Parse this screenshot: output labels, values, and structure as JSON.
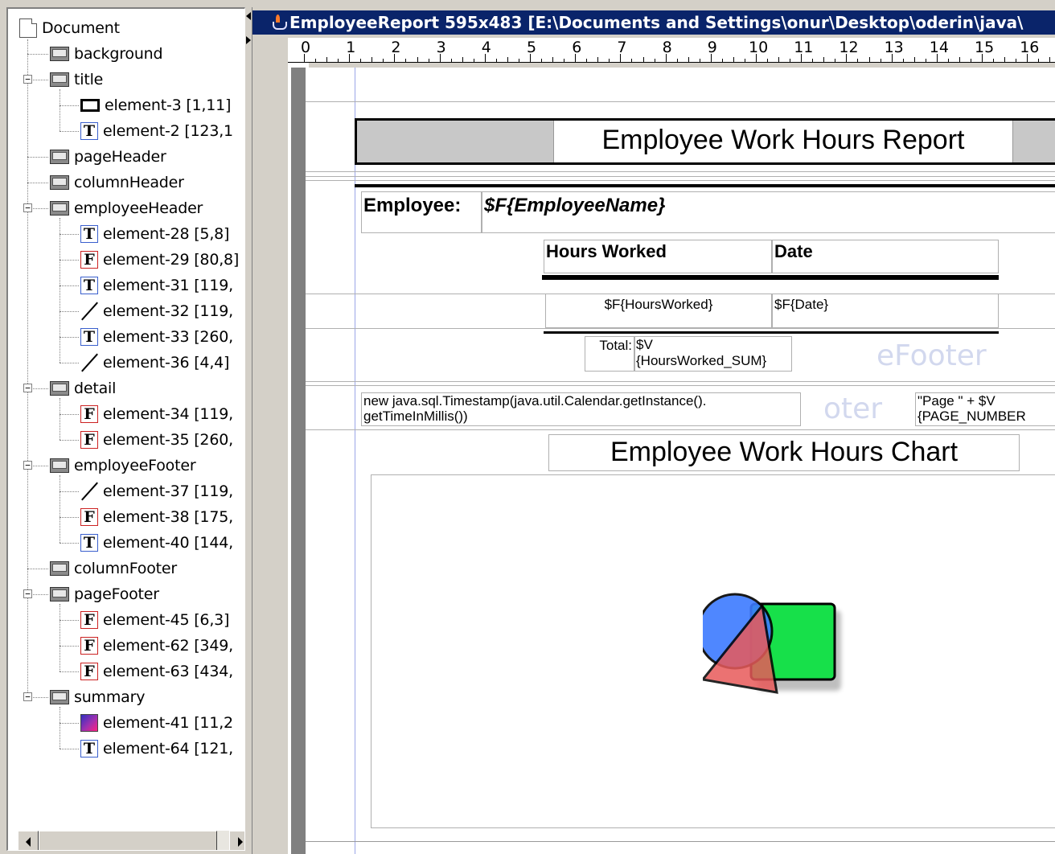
{
  "tree": {
    "root": "Document",
    "bands": [
      {
        "label": "background",
        "children": []
      },
      {
        "label": "title",
        "children": [
          {
            "label": "element-3 [1,11]",
            "icon": "rectangle-icon"
          },
          {
            "label": "element-2 [123,1",
            "icon": "static-text-icon"
          }
        ]
      },
      {
        "label": "pageHeader",
        "children": []
      },
      {
        "label": "columnHeader",
        "children": []
      },
      {
        "label": "employeeHeader",
        "children": [
          {
            "label": "element-28 [5,8]",
            "icon": "static-text-icon"
          },
          {
            "label": "element-29 [80,8]",
            "icon": "text-field-icon"
          },
          {
            "label": "element-31 [119,",
            "icon": "static-text-icon"
          },
          {
            "label": "element-32 [119,",
            "icon": "line-icon"
          },
          {
            "label": "element-33 [260,",
            "icon": "static-text-icon"
          },
          {
            "label": "element-36 [4,4]",
            "icon": "line-icon"
          }
        ]
      },
      {
        "label": "detail",
        "children": [
          {
            "label": "element-34 [119,",
            "icon": "text-field-icon"
          },
          {
            "label": "element-35 [260,",
            "icon": "text-field-icon"
          }
        ]
      },
      {
        "label": "employeeFooter",
        "children": [
          {
            "label": "element-37 [119,",
            "icon": "line-icon"
          },
          {
            "label": "element-38 [175,",
            "icon": "text-field-icon"
          },
          {
            "label": "element-40 [144,",
            "icon": "static-text-icon"
          }
        ]
      },
      {
        "label": "columnFooter",
        "children": []
      },
      {
        "label": "pageFooter",
        "children": [
          {
            "label": "element-45 [6,3]",
            "icon": "text-field-icon"
          },
          {
            "label": "element-62 [349,",
            "icon": "text-field-icon"
          },
          {
            "label": "element-63 [434,",
            "icon": "text-field-icon"
          }
        ]
      },
      {
        "label": "summary",
        "children": [
          {
            "label": "element-41 [11,2",
            "icon": "image-icon"
          },
          {
            "label": "element-64 [121,",
            "icon": "static-text-icon"
          }
        ]
      }
    ]
  },
  "editor": {
    "title": "EmployeeReport 595x483 [E:\\Documents and Settings\\onur\\Desktop\\oderin\\java\\",
    "ruler": [
      "0",
      "1",
      "2",
      "3",
      "4",
      "5",
      "6",
      "7",
      "8",
      "9",
      "10",
      "11",
      "12",
      "13",
      "14",
      "15",
      "16"
    ]
  },
  "report": {
    "title": "Employee Work Hours Report",
    "employee_label": "Employee:",
    "employee_field": "$F{EmployeeName}",
    "col_hours": "Hours Worked",
    "col_date": "Date",
    "detail_hours": "$F{HoursWorked}",
    "detail_date": "$F{Date}",
    "total_label": "Total:",
    "total_line1": "$V",
    "total_line2": "{HoursWorked_SUM}",
    "footer_expr_line1": "new java.sql.Timestamp(java.util.Calendar.getInstance().",
    "footer_expr_line2": "getTimeInMillis())",
    "page_expr_line1": "\"Page \" + $V",
    "page_expr_line2": "{PAGE_NUMBER",
    "chart_title": "Employee Work Hours Chart",
    "ghost_band_1": "eFooter",
    "ghost_band_2": "oter"
  }
}
